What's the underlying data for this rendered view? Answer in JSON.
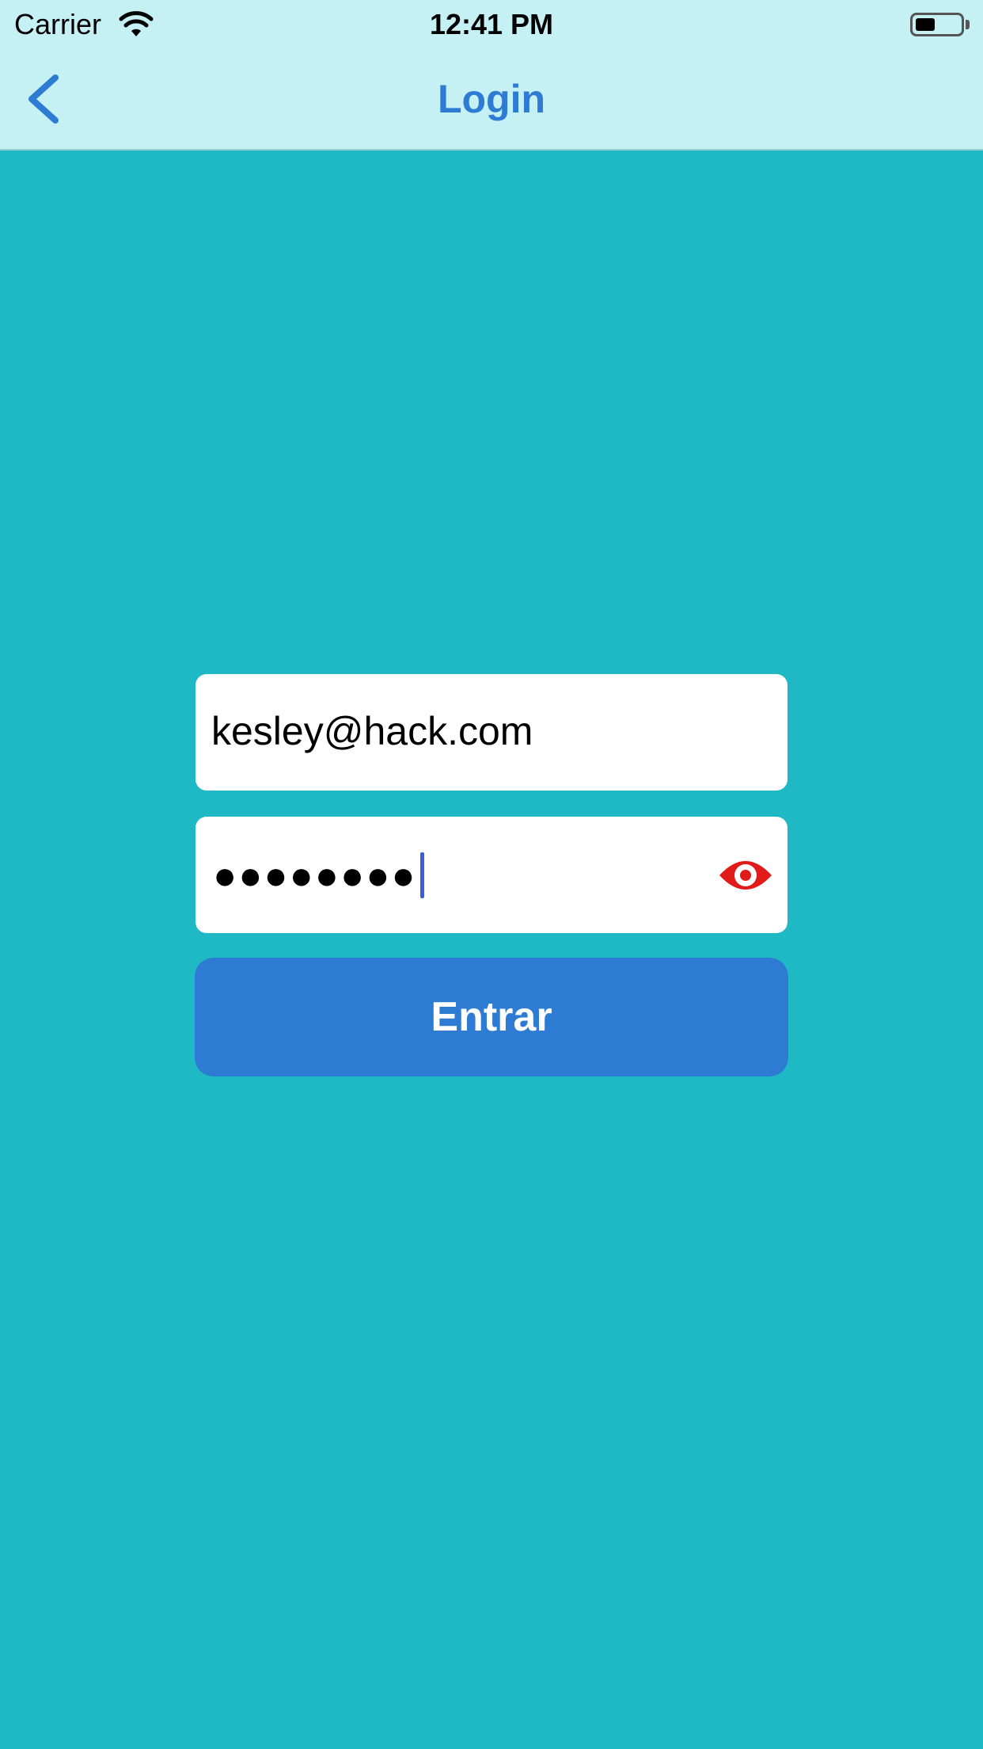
{
  "status_bar": {
    "carrier": "Carrier",
    "time": "12:41 PM",
    "wifi_icon": "wifi-icon",
    "battery_icon": "battery-icon",
    "battery_level": 0.45
  },
  "nav": {
    "title": "Login",
    "back_icon": "chevron-left-icon"
  },
  "form": {
    "email_value": "kesley@hack.com",
    "password_value": "●●●●●●●●",
    "show_password_icon": "eye-icon",
    "submit_label": "Entrar"
  },
  "colors": {
    "background": "#1fb9c6",
    "header": "#c5f0f4",
    "accent": "#2d7bd3",
    "eye": "#e11a1a"
  }
}
